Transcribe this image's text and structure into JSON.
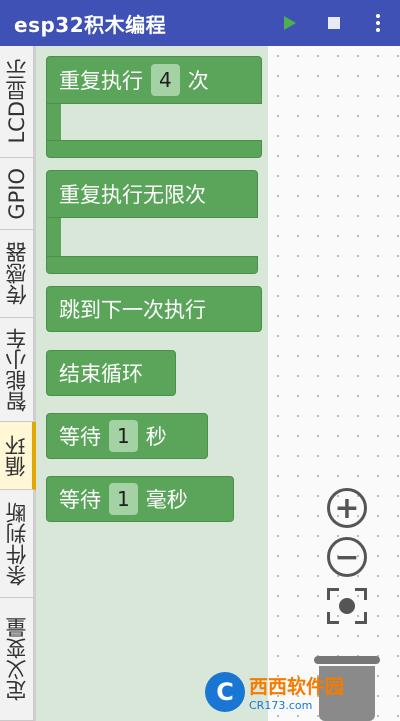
{
  "app": {
    "title": "esp32积木编程"
  },
  "toolbar": {
    "run_icon": "play-icon",
    "stop_icon": "stop-icon",
    "menu_icon": "more-vert-icon"
  },
  "categories": [
    {
      "label": "LCD显示",
      "active": false
    },
    {
      "label": "GPIO",
      "active": false
    },
    {
      "label": "传感器",
      "active": false
    },
    {
      "label": "智能小车",
      "active": false
    },
    {
      "label": "循环",
      "active": true
    },
    {
      "label": "条件判断",
      "active": false
    },
    {
      "label": "定义变量",
      "active": false
    }
  ],
  "blocks": {
    "repeat": {
      "label": "重复执行",
      "value": "4",
      "suffix": "次"
    },
    "repeat_forever": {
      "label": "重复执行无限次"
    },
    "continue": {
      "label": "跳到下一次执行"
    },
    "break": {
      "label": "结束循环"
    },
    "wait_seconds": {
      "label": "等待",
      "value": "1",
      "suffix": "秒"
    },
    "wait_ms": {
      "label": "等待",
      "value": "1",
      "suffix": "毫秒"
    }
  },
  "zoom": {
    "in_label": "+",
    "out_label": "−"
  },
  "colors": {
    "appbar": "#3f51b5",
    "block": "#5ba55b",
    "flyout": "#d8e7d8",
    "active_tab": "#fff7d6"
  },
  "watermark": {
    "logo": "C",
    "name": "西西软件园",
    "url": "CR173.com"
  }
}
